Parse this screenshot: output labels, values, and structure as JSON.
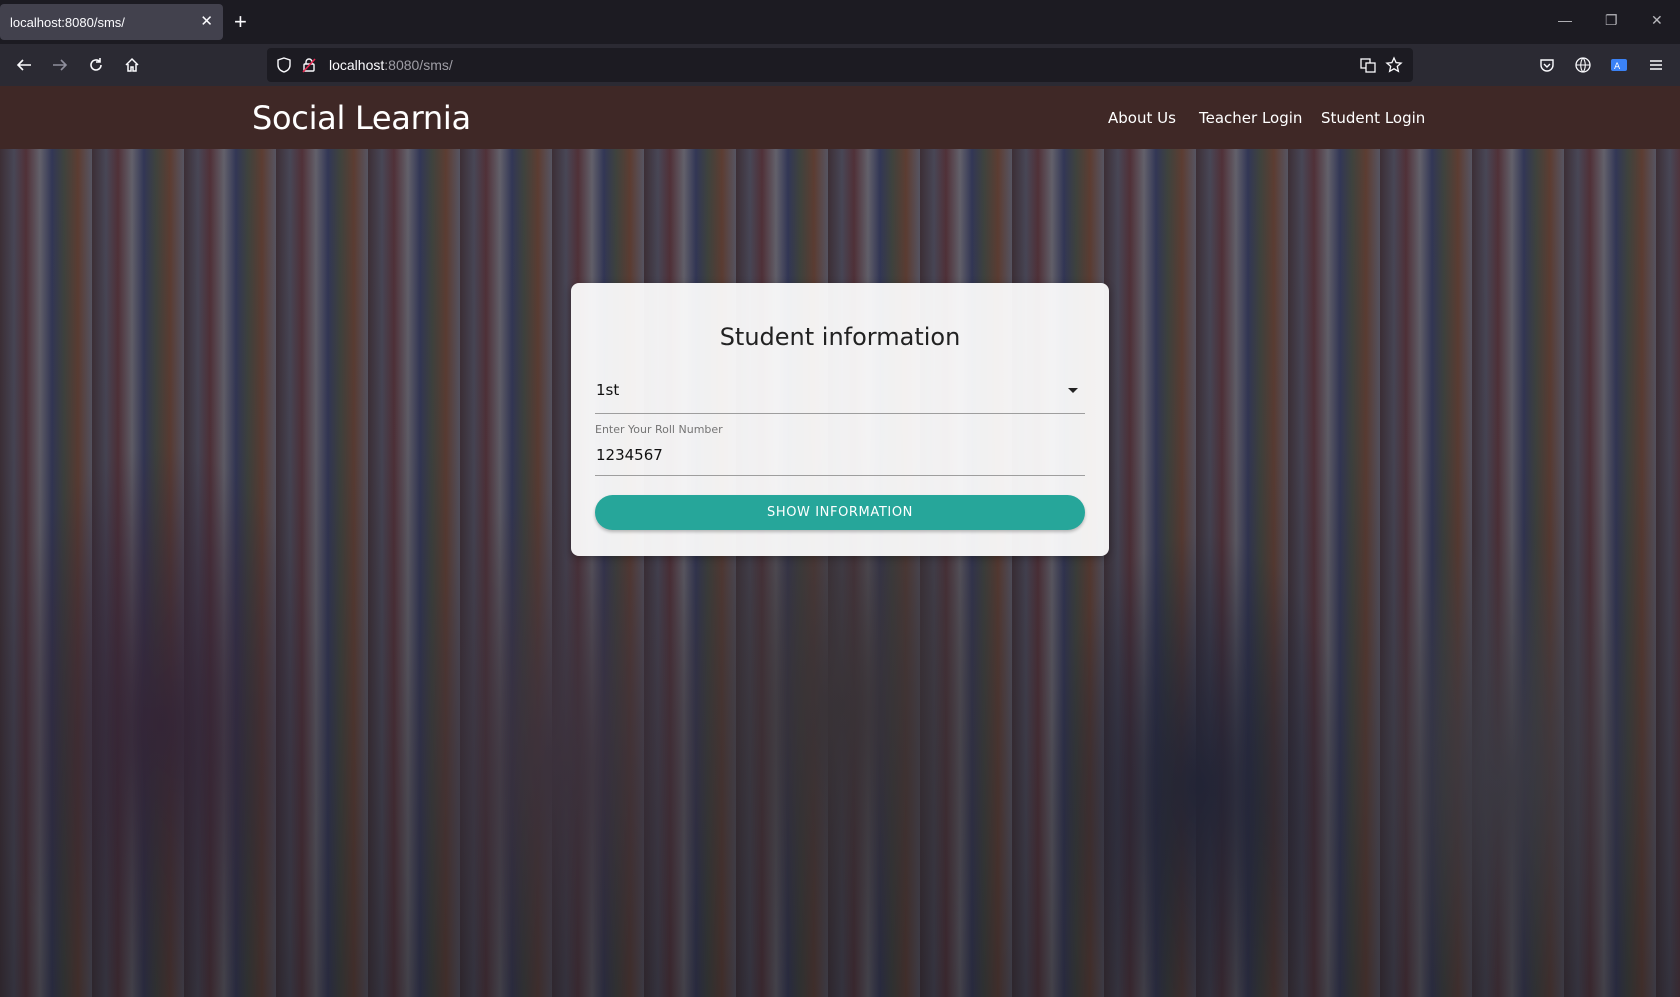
{
  "browser": {
    "tab_title": "localhost:8080/sms/",
    "tab_close": "✕",
    "new_tab": "+",
    "url_host": "localhost",
    "url_rest": ":8080/sms/",
    "window_controls": {
      "minimize": "—",
      "restore": "❐",
      "close": "✕"
    }
  },
  "site": {
    "brand": "Social Learnia",
    "menu": [
      "About Us",
      "Teacher Login",
      "Student Login"
    ]
  },
  "form": {
    "title": "Student information",
    "class_select_value": "1st",
    "roll_label": "Enter Your Roll Number",
    "roll_value": "1234567",
    "submit_label": "SHOW INFORMATION"
  },
  "colors": {
    "header_bg": "#3f2826",
    "button": "#26a69a"
  },
  "icons": [
    "back-icon",
    "forward-icon",
    "reload-icon",
    "home-icon",
    "shield-icon",
    "lock-icon",
    "translate-icon",
    "star-icon",
    "pocket-icon",
    "globe-icon",
    "extension-icon",
    "menu-icon"
  ]
}
